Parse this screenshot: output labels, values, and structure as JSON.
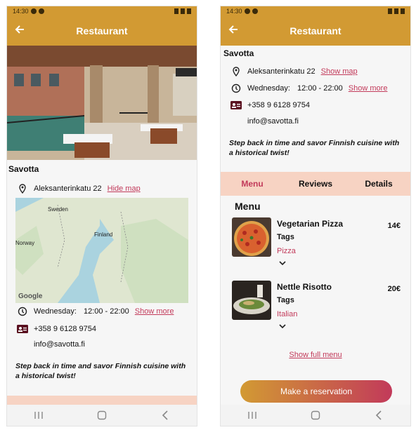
{
  "status": {
    "time": "14:30"
  },
  "appbar": {
    "title": "Restaurant"
  },
  "restaurant": {
    "name": "Savotta",
    "address": "Aleksanterinkatu 22",
    "hide_map": "Hide map",
    "show_map": "Show map",
    "day": "Wednesday:",
    "hours": "12:00 - 22:00",
    "show_more": "Show more",
    "phone": "+358 9 6128 9754",
    "email": "info@savotta.fi",
    "description": "Step back in time and savor Finnish cuisine with a historical twist!"
  },
  "map": {
    "labels": {
      "sweden": "Sweden",
      "finland": "Finland",
      "norway": "Norway"
    },
    "provider": "Google"
  },
  "tabs": [
    "Menu",
    "Reviews",
    "Details"
  ],
  "menu": {
    "title": "Menu",
    "items": [
      {
        "name": "Vegetarian Pizza",
        "tags_label": "Tags",
        "tag": "Pizza",
        "price": "14€"
      },
      {
        "name": "Nettle Risotto",
        "tags_label": "Tags",
        "tag": "Italian",
        "price": "20€"
      }
    ],
    "show_full": "Show full menu"
  },
  "reserve_label": "Make a reservation",
  "colors": {
    "header": "#d29a33",
    "accent": "#c23a5a",
    "tabs_bg": "#f7d3c3"
  }
}
